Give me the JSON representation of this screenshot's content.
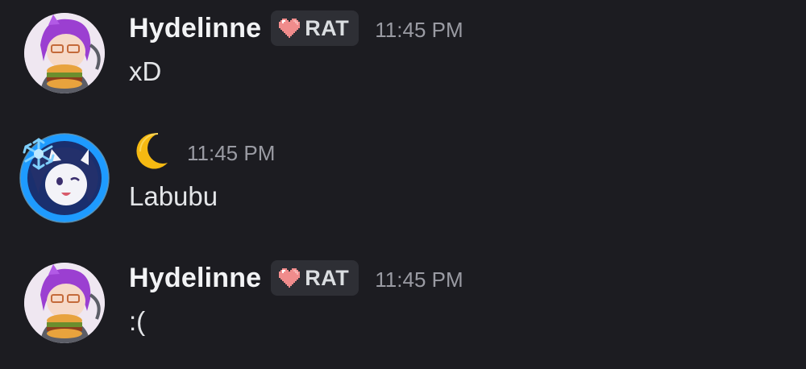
{
  "messages": [
    {
      "username": "Hydelinne",
      "tag": {
        "icon": "heart-icon",
        "label": "RAT"
      },
      "timestamp": "11:45 PM",
      "text": "xD",
      "avatar": "hydelinne-avatar"
    },
    {
      "username": "",
      "name_icon": "crescent-moon-icon",
      "timestamp": "11:45 PM",
      "text": "Labubu",
      "avatar": "moon-user-avatar"
    },
    {
      "username": "Hydelinne",
      "tag": {
        "icon": "heart-icon",
        "label": "RAT"
      },
      "timestamp": "11:45 PM",
      "text": ":(",
      "avatar": "hydelinne-avatar"
    }
  ],
  "colors": {
    "background": "#1c1c21",
    "username": "#f2f3f5",
    "timestamp": "#9a9ba3",
    "message_text": "#e3e5e8",
    "tag_background": "#2e2f35",
    "heart": "#f08c8c",
    "avatar_ring": "#1e9bff"
  }
}
